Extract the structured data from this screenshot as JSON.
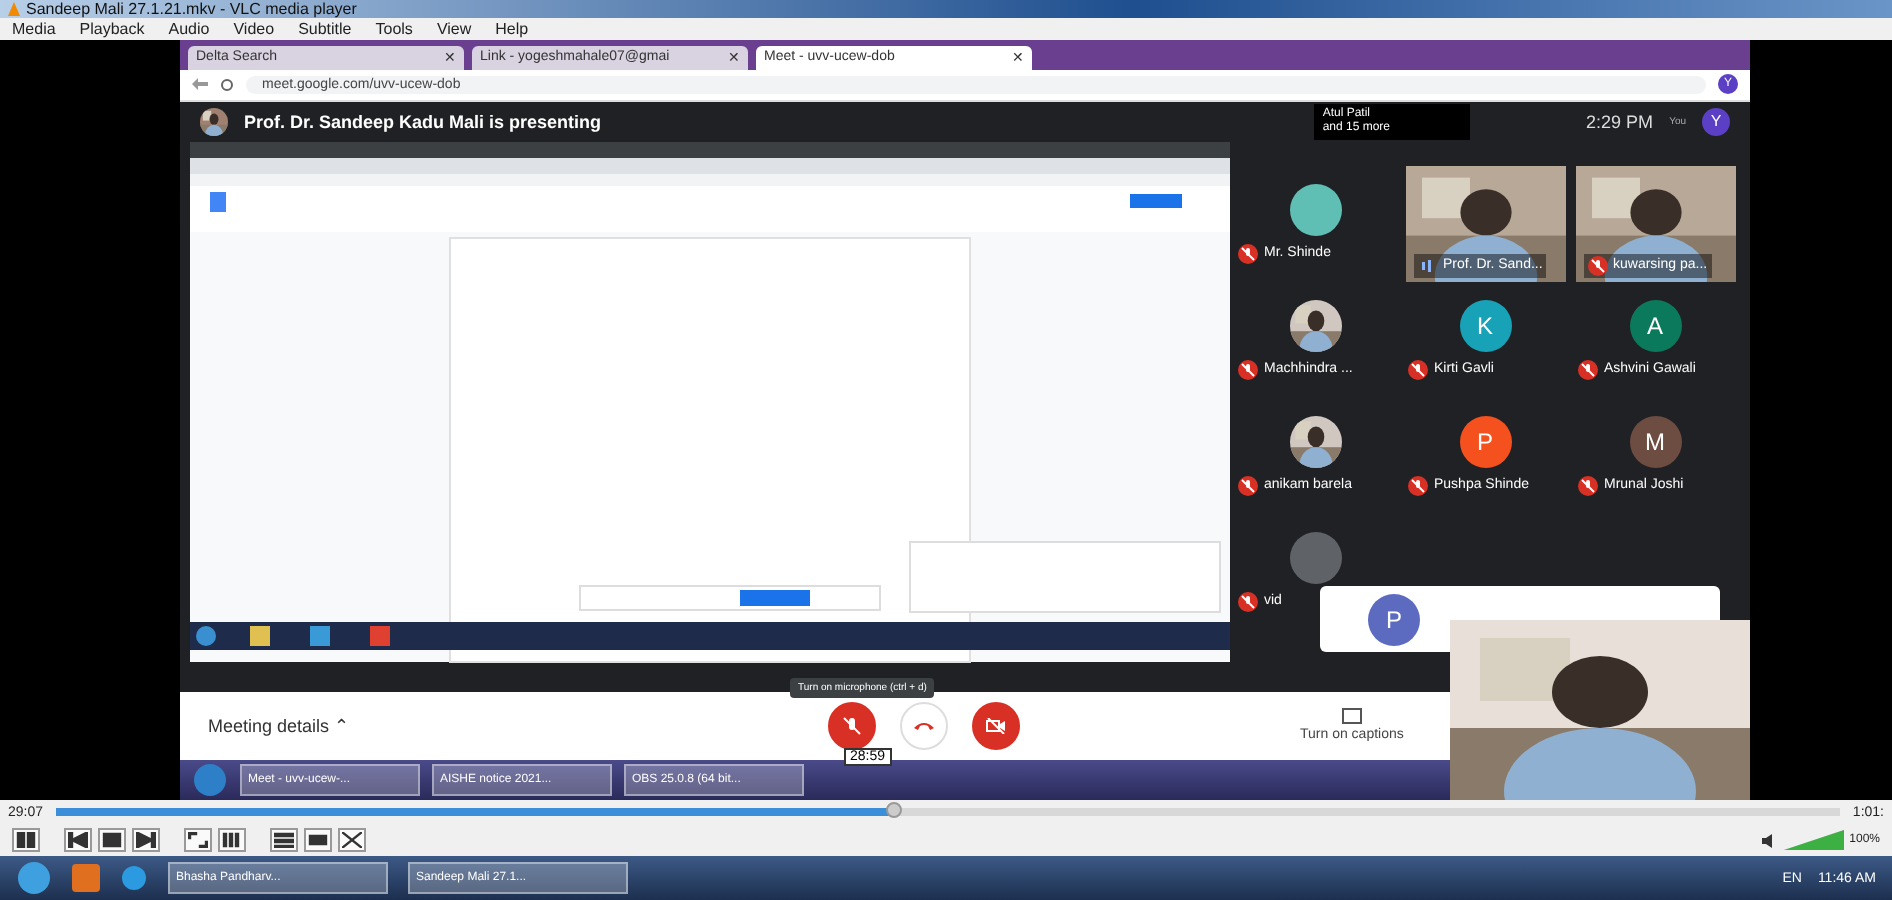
{
  "window": {
    "title": "Sandeep Mali 27.1.21.mkv - VLC media player"
  },
  "menu": [
    "Media",
    "Playback",
    "Audio",
    "Video",
    "Subtitle",
    "Tools",
    "View",
    "Help"
  ],
  "browser": {
    "tabs": [
      {
        "label": "Delta Search",
        "close": "✕",
        "selected": false
      },
      {
        "label": "Link - yogeshmahale07@gmai",
        "close": "✕",
        "selected": false
      },
      {
        "label": "Meet - uvv-ucew-dob",
        "close": "✕",
        "selected": true
      }
    ],
    "address": "meet.google.com/uvv-ucew-dob",
    "profile_initial": "Y"
  },
  "meet": {
    "presenting": "Prof. Dr. Sandeep Kadu Mali is presenting",
    "others": "Atul Patil\nand 15 more",
    "time": "2:29 PM",
    "you_label": "You",
    "you_initial": "Y",
    "participants": [
      {
        "name": "Mr. Shinde",
        "kind": "blank",
        "color": "#5fbfb4",
        "muted": true
      },
      {
        "name": "Prof. Dr. Sand...",
        "kind": "video",
        "muted": false
      },
      {
        "name": "kuwarsing pa...",
        "kind": "video",
        "muted": true
      },
      {
        "name": "Machhindra ...",
        "muted": true
      },
      {
        "name": "Kirti Gavli",
        "kind": "letter",
        "initial": "K",
        "color": "#17a2b8",
        "muted": true
      },
      {
        "name": "Ashvini Gawali",
        "kind": "letter",
        "initial": "A",
        "color": "#0b7a5c",
        "muted": true
      },
      {
        "name": "anikam barela",
        "muted": true
      },
      {
        "name": "Pushpa Shinde",
        "kind": "letter",
        "initial": "P",
        "color": "#f4511e",
        "muted": true
      },
      {
        "name": "Mrunal Joshi",
        "kind": "letter",
        "initial": "M",
        "color": "#6d4c41",
        "muted": true
      },
      {
        "name": "vid",
        "kind": "blank",
        "color": "#5f6368",
        "muted": true
      }
    ],
    "popup_initial": "P",
    "meeting_details": "Meeting details",
    "meeting_details_caret": "⌃",
    "tooltip": "Turn on microphone (ctrl + d)",
    "timer": "28:59",
    "controls": [
      {
        "kind": "mic",
        "off": true
      },
      {
        "kind": "hangup",
        "off": false
      },
      {
        "kind": "camera",
        "off": true
      }
    ],
    "captions": "Turn on captions",
    "taskbar": [
      {
        "label": "Meet - uvv-ucew-..."
      },
      {
        "label": "AISHE notice 2021..."
      },
      {
        "label": "OBS 25.0.8 (64 bit..."
      }
    ]
  },
  "player": {
    "elapsed": "29:07",
    "total": "1:01:",
    "level": 0.47,
    "volume": {
      "text": "100%",
      "level": 1
    }
  },
  "taskbar": {
    "items": [
      {
        "label": "Bhasha Pandharv..."
      },
      {
        "label": "Sandeep Mali 27.1..."
      }
    ],
    "language": "EN",
    "clock": "11:46 AM"
  }
}
